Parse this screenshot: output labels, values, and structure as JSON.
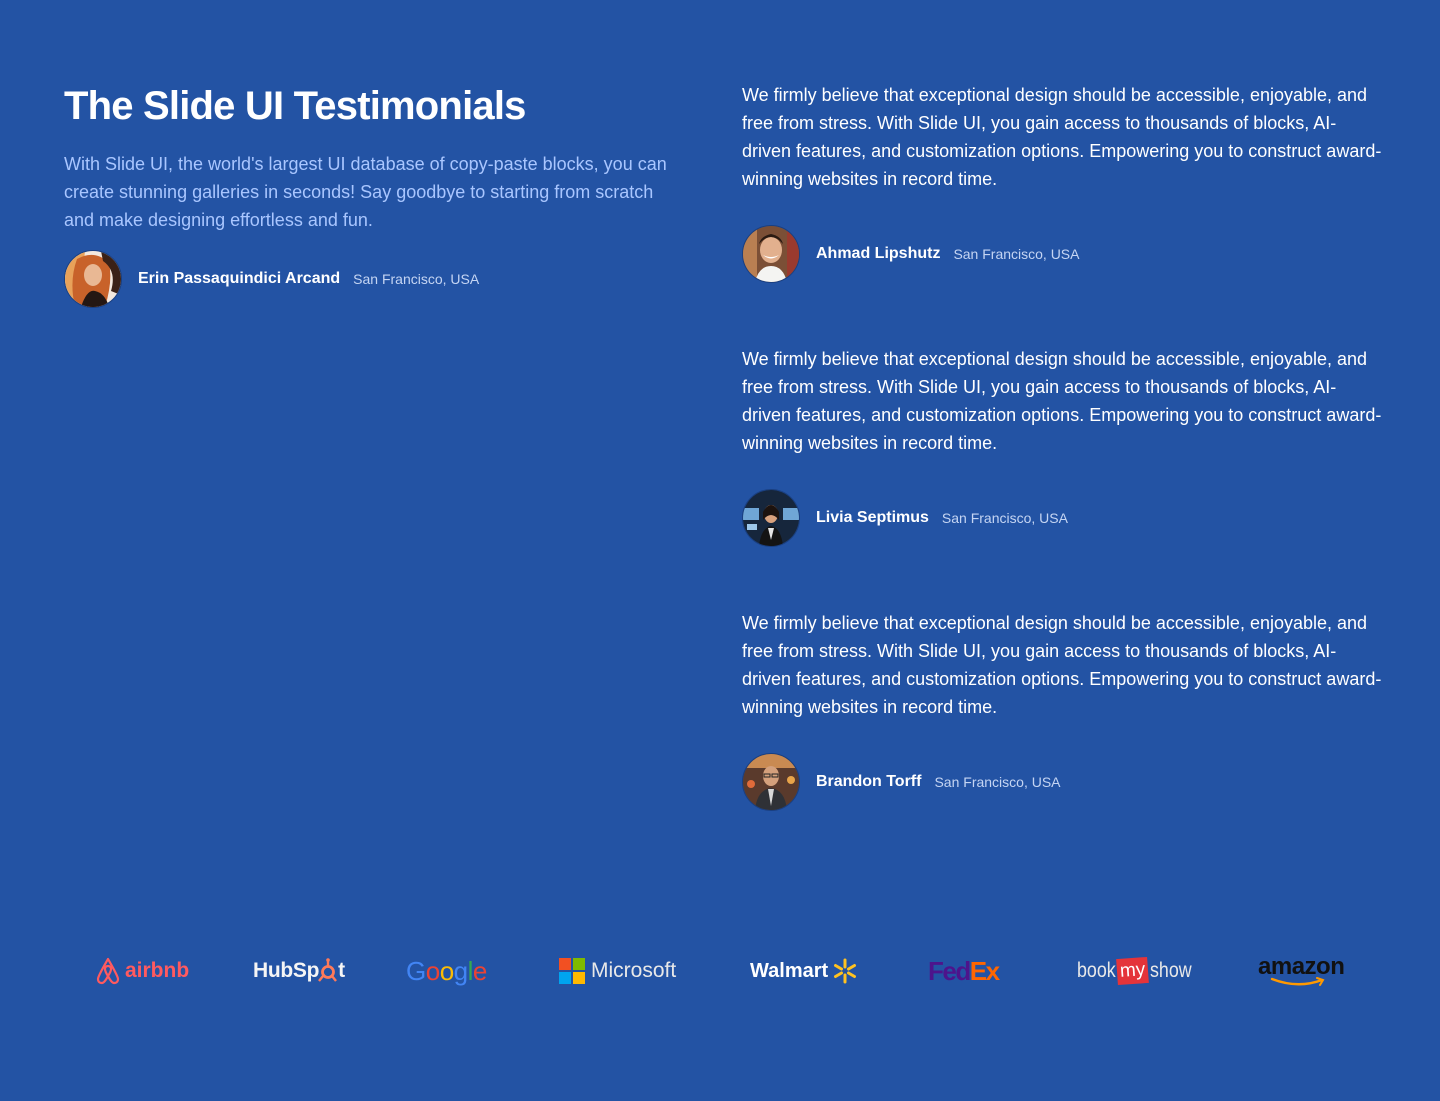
{
  "section": {
    "title": "The Slide UI Testimonials",
    "intro": "With Slide UI, the world's largest UI database of copy-paste blocks, you can create stunning galleries in seconds! Say goodbye to starting from scratch and make designing effortless and fun.",
    "featured_author": {
      "name": "Erin Passaquindici Arcand",
      "location": "San Francisco, USA"
    }
  },
  "testimonials": [
    {
      "quote": "We firmly believe that exceptional design should be accessible, enjoyable, and free from stress. With Slide UI, you gain access to thousands of blocks, AI-driven features, and customization options. Empowering you to construct award-winning websites in record time.",
      "name": "Ahmad Lipshutz",
      "location": "San Francisco, USA"
    },
    {
      "quote": "We firmly believe that exceptional design should be accessible, enjoyable, and free from stress. With Slide UI, you gain access to thousands of blocks, AI-driven features, and customization options. Empowering you to construct award-winning websites in record time.",
      "name": "Livia Septimus",
      "location": "San Francisco, USA"
    },
    {
      "quote": "We firmly believe that exceptional design should be accessible, enjoyable, and free from stress. With Slide UI, you gain access to thousands of blocks, AI-driven features, and customization options. Empowering you to construct award-winning websites in record time.",
      "name": "Brandon Torff",
      "location": "San Francisco, USA"
    }
  ],
  "logos": {
    "airbnb": "airbnb",
    "hubspot_a": "HubSp",
    "hubspot_b": "t",
    "google": [
      "G",
      "o",
      "o",
      "g",
      "l",
      "e"
    ],
    "microsoft": "Microsoft",
    "walmart": "Walmart",
    "fedex_a": "Fed",
    "fedex_b": "Ex",
    "bms_a": "book",
    "bms_b": "my",
    "bms_c": "show",
    "amazon": "amazon"
  },
  "colors": {
    "background": "#2353a4",
    "intro_text": "#a9c6ff",
    "airbnb": "#ff5a5f",
    "hubspot_accent": "#ff7a59",
    "fedex_purple": "#4d148c",
    "fedex_orange": "#ff6600",
    "bms_red": "#e4343a",
    "amazon_arrow": "#ff9900"
  }
}
